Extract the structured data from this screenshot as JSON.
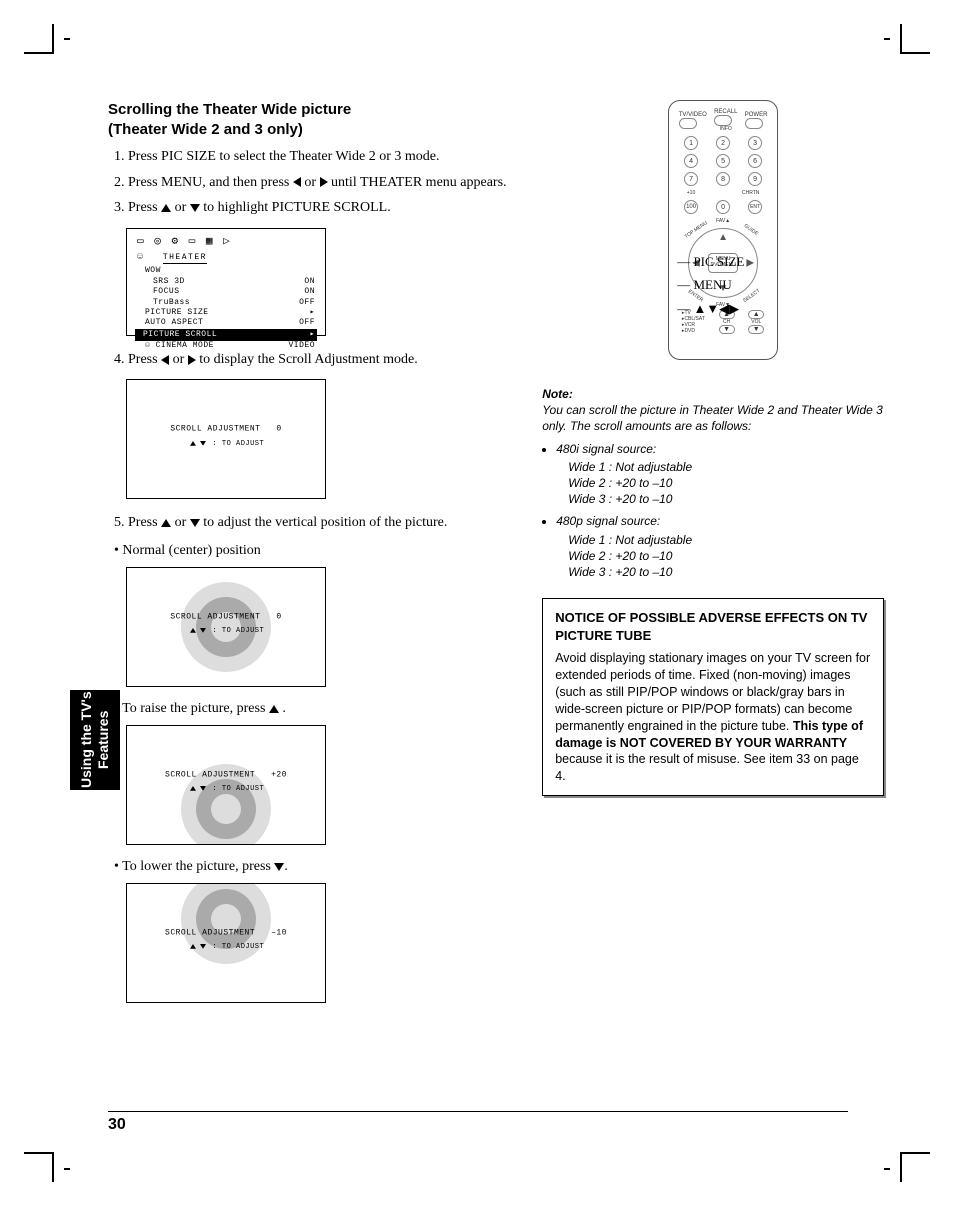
{
  "side_tab": "Using the TV's\nFeatures",
  "page_number": "30",
  "title_line1": "Scrolling the Theater Wide picture",
  "title_line2": "(Theater Wide 2 and 3 only)",
  "steps": {
    "s1": "Press PIC SIZE to select the Theater Wide 2 or 3 mode.",
    "s2a": "Press MENU, and then press ",
    "s2b": " or ",
    "s2c": " until THEATER menu appears.",
    "s3a": "Press ",
    "s3b": " or ",
    "s3c": " to highlight PICTURE SCROLL.",
    "s4a": "Press ",
    "s4b": " or ",
    "s4c": " to display the Scroll Adjustment mode.",
    "s5a": "Press ",
    "s5b": " or ",
    "s5c": " to adjust the vertical position of the picture."
  },
  "bullets": {
    "normal": "Normal (center) position",
    "raise_a": "To raise the picture, press ",
    "raise_b": " .",
    "lower_a": "To lower the picture, press ",
    "lower_b": "."
  },
  "osd": {
    "icons_row": "▭ ◎ ⚙ ▭ ▦ ▷",
    "menu_tab": "THEATER",
    "wow": "WOW",
    "srs3d": "SRS 3D",
    "srs3d_v": "ON",
    "focus": "FOCUS",
    "focus_v": "ON",
    "trubass": "TruBass",
    "trubass_v": "OFF",
    "picsize": "PICTURE SIZE",
    "picsize_v": "▸",
    "autoaspect": "AUTO ASPECT",
    "autoaspect_v": "OFF",
    "picscroll": "PICTURE SCROLL",
    "picscroll_v": "▸",
    "cinema": "CINEMA MODE",
    "cinema_v": "VIDEO"
  },
  "scroll": {
    "label": "SCROLL  ADJUSTMENT",
    "hint": ": TO  ADJUST",
    "v0": "0",
    "vplus": "+20",
    "vminus": "–10"
  },
  "remote": {
    "top1": "TV/VIDEO",
    "top2": "RECALL",
    "top3": "POWER",
    "info": "INFO",
    "n1": "1",
    "n2": "2",
    "n3": "3",
    "n4": "4",
    "n5": "5",
    "n6": "6",
    "n7": "7",
    "n8": "8",
    "n9": "9",
    "n0": "0",
    "plus10": "+10",
    "chrtn": "CHRTN",
    "ent": "ENT",
    "n100": "100",
    "fav_up": "FAV▲",
    "fav_dn": "FAV▼",
    "menu": "MENU",
    "dvdmenu": "DVDMENU",
    "tl": "TOP MENU",
    "tr": "GUIDE",
    "bl": "ENTER",
    "br": "SELECT",
    "dev1": "TV",
    "dev2": "CBL/SAT",
    "dev3": "VCR",
    "dev4": "DVD",
    "ch": "CH",
    "vol": "VOL"
  },
  "callouts": {
    "picsize": "PIC SIZE",
    "menu": "MENU",
    "arrows": "▲▼◀▶"
  },
  "note": {
    "title": "Note:",
    "intro": "You can scroll the picture in Theater Wide 2 and Theater Wide 3 only. The scroll amounts are as follows:",
    "src1": "480i signal source:",
    "w1": "Wide 1  :  Not adjustable",
    "w2": "Wide 2  :  +20 to –10",
    "w3": "Wide 3  :  +20 to –10",
    "src2": "480p signal source:"
  },
  "notice": {
    "title": "NOTICE OF POSSIBLE ADVERSE EFFECTS ON TV PICTURE TUBE",
    "body1": "Avoid displaying stationary images on your TV screen for extended periods of time. Fixed (non-moving) images (such as still PIP/POP windows or black/gray bars in wide-screen picture or PIP/POP formats) can become permanently engrained in the picture tube. ",
    "bold": "This type of damage is NOT COVERED BY YOUR WARRANTY",
    "body2": " because it is the result of misuse. See item 33 on page 4."
  }
}
